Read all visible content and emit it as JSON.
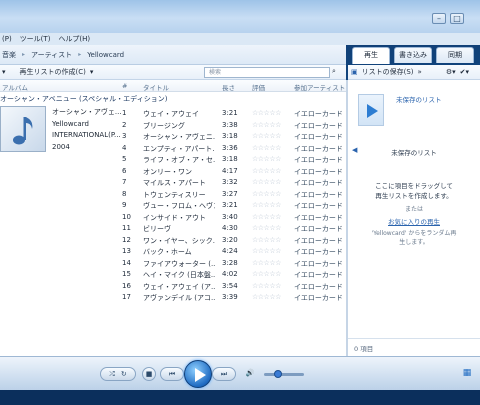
{
  "menu": {
    "items": [
      "(P)",
      "ツール(T)",
      "ヘルプ(H)"
    ]
  },
  "window": {
    "minimize": "–",
    "maximize": "□"
  },
  "breadcrumb": [
    "音楽",
    "アーティスト",
    "Yellowcard"
  ],
  "tabs": [
    {
      "label": "再生",
      "active": true
    },
    {
      "label": "書き込み",
      "active": false
    },
    {
      "label": "同期",
      "active": false
    }
  ],
  "toolbar": {
    "create_playlist": "再生リストの作成(C)",
    "search_placeholder": "検索"
  },
  "right_toolbar": {
    "save_list": "リストの保存(S)",
    "more": "»"
  },
  "columns": {
    "album": "アルバム",
    "num": "#",
    "title": "タイトル",
    "length": "長さ",
    "rating": "評価",
    "artist": "参加アーティスト"
  },
  "album": {
    "header": "オーシャン・アベニュー (スペシャル・エディション)",
    "title": "オーシャン・アヴェ...",
    "artist": "Yellowcard",
    "label": "INTERNATIONAL(P...",
    "year": "2004"
  },
  "tracks": [
    {
      "num": "1",
      "title": "ウェイ・アウェイ",
      "length": "3:21",
      "rating": "☆☆☆☆☆",
      "artist": "イエローカード"
    },
    {
      "num": "2",
      "title": "ブリージング",
      "length": "3:38",
      "rating": "☆☆☆☆☆",
      "artist": "イエローカード"
    },
    {
      "num": "3",
      "title": "オーシャン・アヴェニ...",
      "length": "3:18",
      "rating": "☆☆☆☆☆",
      "artist": "イエローカード"
    },
    {
      "num": "4",
      "title": "エンプティ・アパート...",
      "length": "3:36",
      "rating": "☆☆☆☆☆",
      "artist": "イエローカード"
    },
    {
      "num": "5",
      "title": "ライフ・オブ・ア・セ...",
      "length": "3:18",
      "rating": "☆☆☆☆☆",
      "artist": "イエローカード"
    },
    {
      "num": "6",
      "title": "オンリー・ワン",
      "length": "4:17",
      "rating": "☆☆☆☆☆",
      "artist": "イエローカード"
    },
    {
      "num": "7",
      "title": "マイルス・アパート",
      "length": "3:32",
      "rating": "☆☆☆☆☆",
      "artist": "イエローカード"
    },
    {
      "num": "8",
      "title": "トウェンティスリー",
      "length": "3:27",
      "rating": "☆☆☆☆☆",
      "artist": "イエローカード"
    },
    {
      "num": "9",
      "title": "ヴュー・フロム・ヘヴン",
      "length": "3:21",
      "rating": "☆☆☆☆☆",
      "artist": "イエローカード"
    },
    {
      "num": "10",
      "title": "インサイド・アウト",
      "length": "3:40",
      "rating": "☆☆☆☆☆",
      "artist": "イエローカード"
    },
    {
      "num": "11",
      "title": "ビリーヴ",
      "length": "4:30",
      "rating": "☆☆☆☆☆",
      "artist": "イエローカード"
    },
    {
      "num": "12",
      "title": "ワン・イヤー、シック...",
      "length": "3:20",
      "rating": "☆☆☆☆☆",
      "artist": "イエローカード"
    },
    {
      "num": "13",
      "title": "バック・ホーム",
      "length": "4:24",
      "rating": "☆☆☆☆☆",
      "artist": "イエローカード"
    },
    {
      "num": "14",
      "title": "ファイアウォーター (...",
      "length": "3:28",
      "rating": "☆☆☆☆☆",
      "artist": "イエローカード"
    },
    {
      "num": "15",
      "title": "ヘイ・マイク (日本盤...",
      "length": "4:02",
      "rating": "☆☆☆☆☆",
      "artist": "イエローカード"
    },
    {
      "num": "16",
      "title": "ウェイ・アウェイ (ア...",
      "length": "3:54",
      "rating": "☆☆☆☆☆",
      "artist": "イエローカード"
    },
    {
      "num": "17",
      "title": "アヴァンデイル (アコ...",
      "length": "3:39",
      "rating": "☆☆☆☆☆",
      "artist": "イエローカード"
    }
  ],
  "right_panel": {
    "unsaved_link": "未保存のリスト",
    "list_title": "未保存のリスト",
    "drag_line1": "ここに項目をドラッグして",
    "drag_line2": "再生リストを作成します。",
    "or": "または",
    "favorites_link": "お気に入りの再生",
    "random_line1": "'Yellowcard' からをランダム再",
    "random_line2": "生します。",
    "count": "0 項目"
  },
  "player": {
    "shuffle": "⤮",
    "repeat": "↻",
    "stop": "■",
    "prev": "⏮",
    "next": "⏭",
    "mute": "🔊",
    "volume_fraction": 0.35,
    "view_switch": "▦"
  }
}
